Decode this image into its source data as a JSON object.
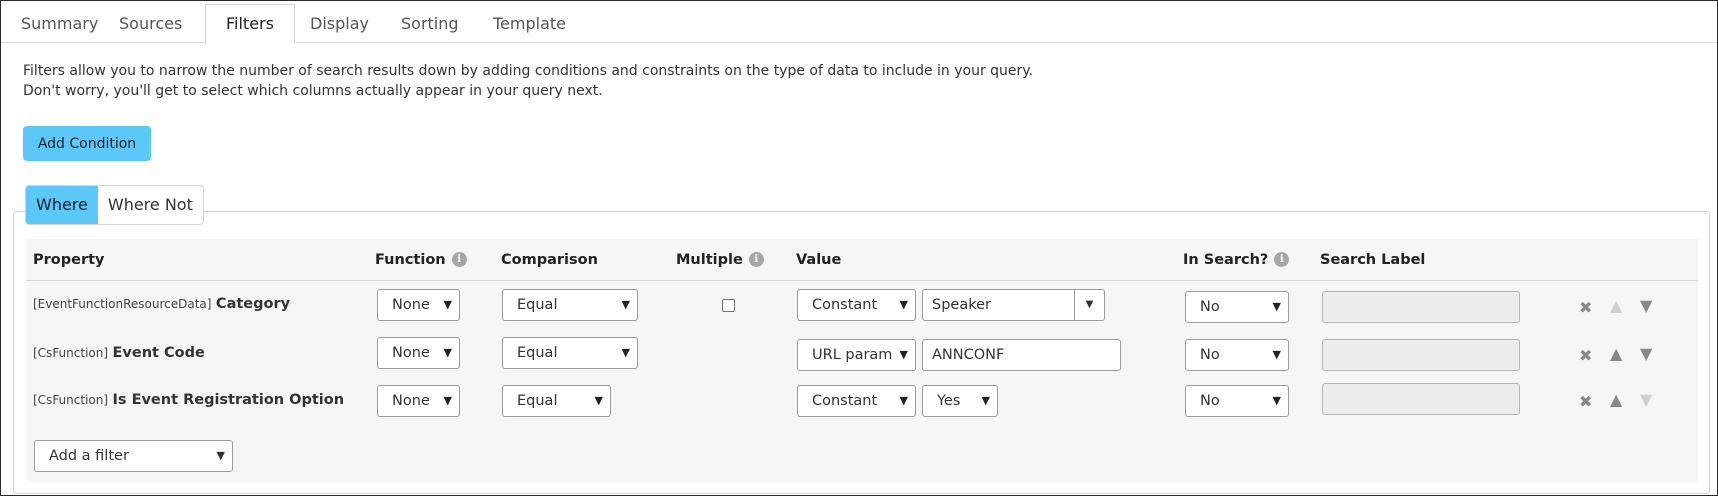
{
  "tabs": [
    "Summary",
    "Sources",
    "Filters",
    "Display",
    "Sorting",
    "Template"
  ],
  "active_tab": "Filters",
  "intro": {
    "line1": "Filters allow you to narrow the number of search results down by adding conditions and constraints on the type of data to include in your query.",
    "line2": "Don't worry, you'll get to select which columns actually appear in your query next."
  },
  "add_condition_label": "Add Condition",
  "subtabs": [
    "Where",
    "Where Not"
  ],
  "columns": {
    "property": "Property",
    "function": "Function",
    "comparison": "Comparison",
    "multiple": "Multiple",
    "value": "Value",
    "in_search": "In Search?",
    "search_label": "Search Label"
  },
  "info_glyph": "i",
  "rows": [
    {
      "class": "[EventFunctionResourceData]",
      "name": "Category",
      "function": "None",
      "comparison": "Equal",
      "value_type": "Constant",
      "value": "Speaker",
      "in_search": "No",
      "search_label": ""
    },
    {
      "class": "[CsFunction]",
      "name": "Event Code",
      "function": "None",
      "comparison": "Equal",
      "value_type": "URL param",
      "value": "ANNCONF",
      "in_search": "No",
      "search_label": ""
    },
    {
      "class": "[CsFunction]",
      "name": "Is Event Registration Option",
      "function": "None",
      "comparison": "Equal",
      "value_type": "Constant",
      "value": "Yes",
      "in_search": "No",
      "search_label": ""
    }
  ],
  "add_filter_placeholder": "Add a filter",
  "icons": {
    "remove": "close-icon",
    "move_up": "arrow-up-icon",
    "move_down": "arrow-down-icon",
    "info": "info-icon",
    "dropdown": "chevron-down-icon"
  },
  "colors": {
    "accent": "#5bc8f7",
    "grid_bg": "#f5f5f5"
  }
}
